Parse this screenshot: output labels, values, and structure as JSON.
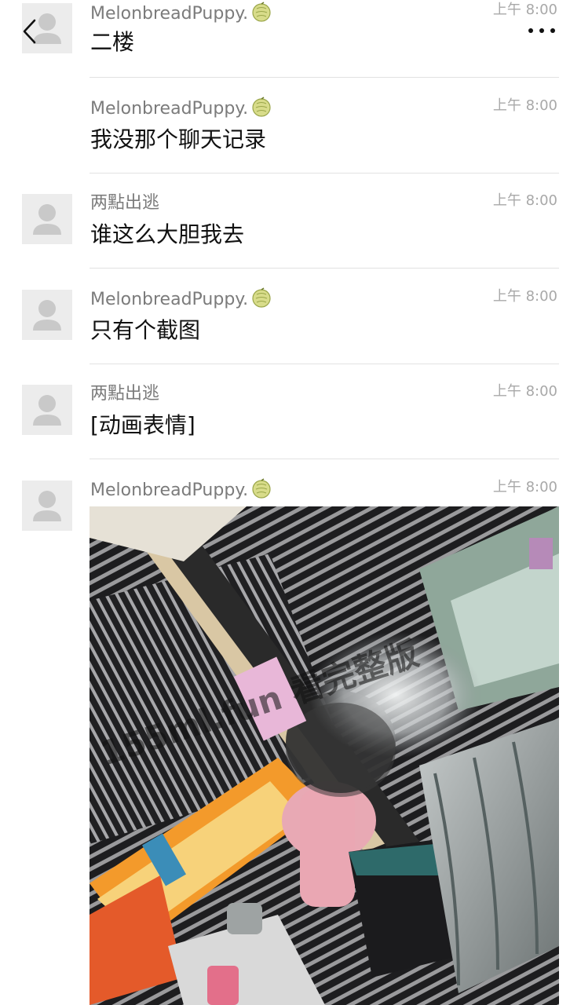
{
  "messages": [
    {
      "sender": "MelonbreadPuppy.",
      "time": "上午 8:00",
      "text": "二楼",
      "avatar": true
    },
    {
      "sender": "MelonbreadPuppy.",
      "time": "上午 8:00",
      "text": "我没那个聊天记录",
      "avatar": false
    },
    {
      "sender": "两點出逃",
      "time": "上午 8:00",
      "text": "谁这么大胆我去",
      "avatar": true
    },
    {
      "sender": "MelonbreadPuppy.",
      "time": "上午 8:00",
      "text": "只有个截图",
      "avatar": true
    },
    {
      "sender": "两點出逃",
      "time": "上午 8:00",
      "text": "[动画表情]",
      "avatar": true
    },
    {
      "sender": "MelonbreadPuppy.",
      "time": "上午 8:00",
      "text": "",
      "avatar": true
    }
  ],
  "photo": {
    "watermark": "155ml.fun 看完整版"
  },
  "icons": {
    "back": "chevron-left-icon",
    "more": "more-dots-icon",
    "avatar": "default-avatar-icon",
    "melon": "melon-emoji-icon"
  },
  "colors": {
    "name": "#7b7b7b",
    "time": "#a8a8a8",
    "divider": "#e2e2e2",
    "avatar_bg": "#ececec"
  }
}
